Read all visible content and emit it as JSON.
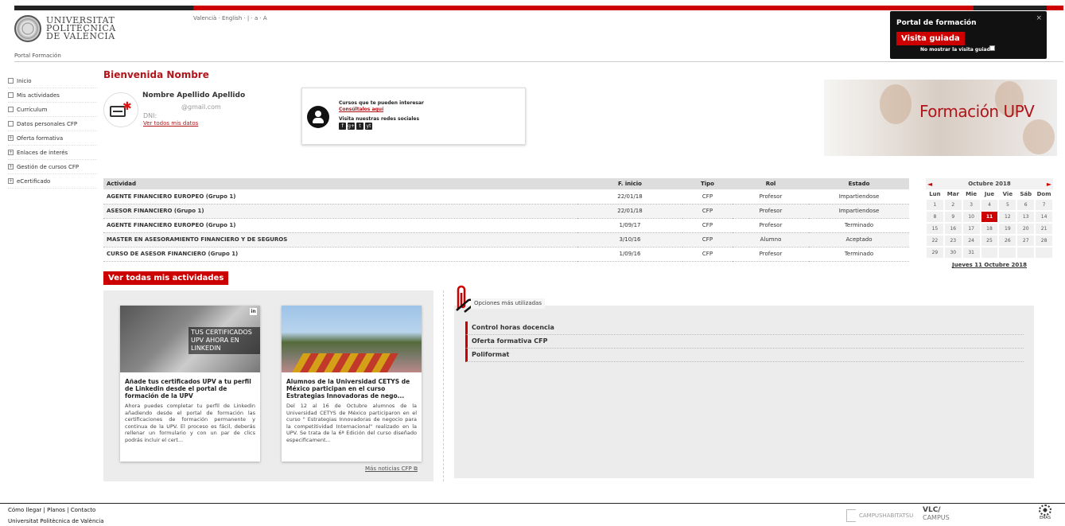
{
  "header": {
    "logo_lines": [
      "UNIVERSITAT",
      "POLITÈCNICA",
      "DE VALÈNCIA"
    ],
    "languages": "Valencià · English · | · a · A",
    "portal_label": "Portal Formación"
  },
  "popup": {
    "title": "Portal de formación",
    "close": "×",
    "button": "Visita guiada",
    "checkbox_label": "No mostrar la visita guiada"
  },
  "sidebar": {
    "items": [
      {
        "label": "Inicio",
        "box": ""
      },
      {
        "label": "Mis actividades",
        "box": ""
      },
      {
        "label": "Currículum",
        "box": ""
      },
      {
        "label": "Datos personales CFP",
        "box": ""
      },
      {
        "label": "Oferta formativa",
        "box": "+"
      },
      {
        "label": "Enlaces de interés",
        "box": "+"
      },
      {
        "label": "Gestión de cursos CFP",
        "box": "+"
      },
      {
        "label": "eCertificado",
        "box": "+"
      }
    ]
  },
  "profile": {
    "welcome": "Bienvenida Nombre",
    "name": "Nombre Apellido Apellido",
    "email": "@gmail.com",
    "dni": "DNI:",
    "link": "Ver todos mis datos"
  },
  "info_box": {
    "courses_text": "Cursos que te pueden interesar",
    "courses_link": "Consúltalos aquí",
    "social_text": "Visita nuestras redes sociales",
    "social_icons": [
      "f",
      "g+",
      "t",
      "yt"
    ]
  },
  "banner": {
    "text": "Formación UPV"
  },
  "activities": {
    "headers": [
      "Actividad",
      "F. inicio",
      "Tipo",
      "Rol",
      "Estado"
    ],
    "rows": [
      [
        "AGENTE FINANCIERO EUROPEO (Grupo 1)",
        "22/01/18",
        "CFP",
        "Profesor",
        "Impartiendose"
      ],
      [
        "ASESOR FINANCIERO (Grupo 1)",
        "22/01/18",
        "CFP",
        "Profesor",
        "Impartiendose"
      ],
      [
        "AGENTE FINANCIERO EUROPEO (Grupo 1)",
        "1/09/17",
        "CFP",
        "Profesor",
        "Terminado"
      ],
      [
        "MASTER EN ASESORAMIENTO FINANCIERO Y DE SEGUROS",
        "3/10/16",
        "CFP",
        "Alumno",
        "Aceptado"
      ],
      [
        "CURSO DE ASESOR FINANCIERO (Grupo 1)",
        "1/09/16",
        "CFP",
        "Profesor",
        "Terminado"
      ]
    ],
    "see_all": "Ver todas mis actividades"
  },
  "calendar": {
    "prev": "◄",
    "next": "►",
    "title": "Octubre 2018",
    "day_names": [
      "Lun",
      "Mar",
      "Mie",
      "Jue",
      "Vie",
      "Sáb",
      "Dom"
    ],
    "days": [
      "1",
      "2",
      "3",
      "4",
      "5",
      "6",
      "7",
      "8",
      "9",
      "10",
      "11",
      "12",
      "13",
      "14",
      "15",
      "16",
      "17",
      "18",
      "19",
      "20",
      "21",
      "22",
      "23",
      "24",
      "25",
      "26",
      "27",
      "28",
      "29",
      "30",
      "31",
      "",
      "",
      "",
      ""
    ],
    "selected": "11",
    "footer": "Jueves 11 Octubre 2018"
  },
  "news": {
    "cards": [
      {
        "img_badge": "in",
        "img_overlay": "TUS CERTIFICADOS UPV AHORA EN LINKEDIN",
        "title": "Añade tus certificados UPV a tu perfil de Linkedin desde el portal de formación de la UPV",
        "body": "Ahora puedes completar tu perfil de Linkedin añadiendo desde el portal de formación las certificaciones de formación permanente y continua de la UPV. El proceso es fácil, deberás rellenar un formulario y con un par de clics podrás incluir el cert..."
      },
      {
        "img_badge": "",
        "img_overlay": "",
        "title": "Alumnos de la Universidad CETYS de México participan en el curso Estrategias Innovadoras de nego...",
        "body": "Del 12 al 16 de Octubre alumnos de la Universidad CETYS de México participaron en el curso \" Estrategias Innovadoras de negocio para la competitividad Internacional\" realizado en la UPV. Se trata de la 6ª Edición del curso diseñado especificament..."
      }
    ],
    "more": "Más noticias CFP"
  },
  "options": {
    "tab": "Opciones más utilizadas",
    "items": [
      "Control horas docencia",
      "Oferta formativa CFP",
      "Poliformat"
    ]
  },
  "footer": {
    "links": "Cómo llegar | Planos | Contacto",
    "university": "Universitat Politècnica de València",
    "campus_habitat": "CAMPUSHABITATSU",
    "vlc": "VLC/",
    "vlc_campus": "CAMPUS",
    "emas": "EMAS"
  }
}
